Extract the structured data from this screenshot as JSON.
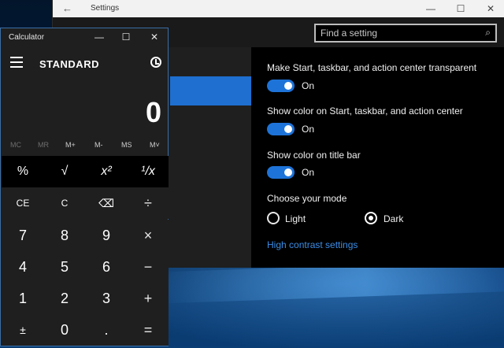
{
  "settings": {
    "window_title": "Settings",
    "search_placeholder": "Find a setting",
    "options": [
      {
        "label": "Make Start, taskbar, and action center transparent",
        "state": "On"
      },
      {
        "label": "Show color on Start, taskbar, and action center",
        "state": "On"
      },
      {
        "label": "Show color on title bar",
        "state": "On"
      }
    ],
    "mode_label": "Choose your mode",
    "mode_options": [
      {
        "label": "Light",
        "selected": false
      },
      {
        "label": "Dark",
        "selected": true
      }
    ],
    "high_contrast_link": "High contrast settings",
    "accent_color": "#1e73d8"
  },
  "calculator": {
    "window_title": "Calculator",
    "mode": "STANDARD",
    "display_value": "0",
    "memory": [
      "MC",
      "MR",
      "M+",
      "M-",
      "MS",
      "M˅"
    ],
    "keys": [
      [
        "%",
        "√",
        "x²",
        "¹/x"
      ],
      [
        "CE",
        "C",
        "⌫",
        "÷"
      ],
      [
        "7",
        "8",
        "9",
        "×"
      ],
      [
        "4",
        "5",
        "6",
        "−"
      ],
      [
        "1",
        "2",
        "3",
        "+"
      ],
      [
        "±",
        "0",
        ".",
        "="
      ]
    ]
  }
}
